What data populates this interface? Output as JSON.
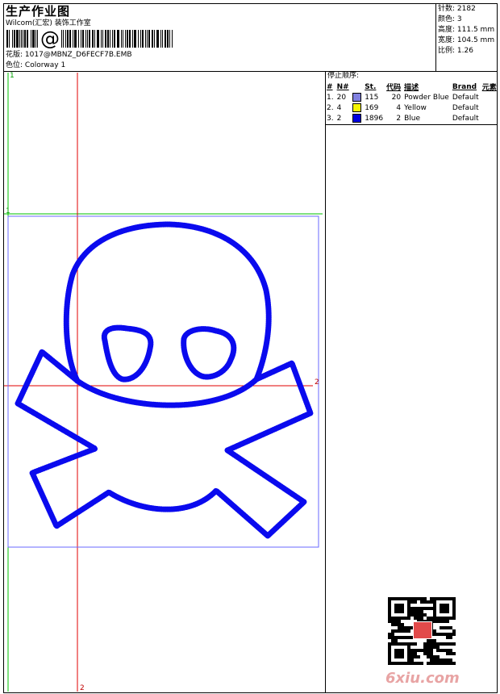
{
  "header": {
    "title": "生产作业图",
    "studio": "Wilcom(汇宏) 装饰工作室",
    "design_label": "花版:",
    "design_file": "1017@MBNZ_D6FECF7B.EMB",
    "colorway_label": "色位:",
    "colorway": "Colorway 1"
  },
  "stats": [
    {
      "label": "针数:",
      "value": "2182"
    },
    {
      "label": "颜色:",
      "value": "3"
    },
    {
      "label": "高度:",
      "value": "111.5 mm"
    },
    {
      "label": "宽度:",
      "value": "104.5 mm"
    },
    {
      "label": "比例:",
      "value": "1.26"
    }
  ],
  "stops": {
    "title": "停止顺序:",
    "columns": [
      "#",
      "N#",
      "St.",
      "代码",
      "描述",
      "Brand",
      "元素"
    ],
    "rows": [
      {
        "idx": "1.",
        "n": "20",
        "color": "#8080e0",
        "st": "115",
        "code": "20",
        "desc": "Powder Blue",
        "brand": "Default"
      },
      {
        "idx": "2.",
        "n": "4",
        "color": "#f5f500",
        "st": "169",
        "code": "4",
        "desc": "Yellow",
        "brand": "Default"
      },
      {
        "idx": "3.",
        "n": "2",
        "color": "#0000e0",
        "st": "1896",
        "code": "2",
        "desc": "Blue",
        "brand": "Default"
      }
    ]
  },
  "guides": {
    "label1": "1",
    "label2": "2"
  },
  "watermark": "6xiu.com",
  "colors": {
    "stitch": "#0a0aee",
    "red_guide": "#e00000",
    "green_guide": "#00c000",
    "blue_guide": "#5050ff"
  }
}
